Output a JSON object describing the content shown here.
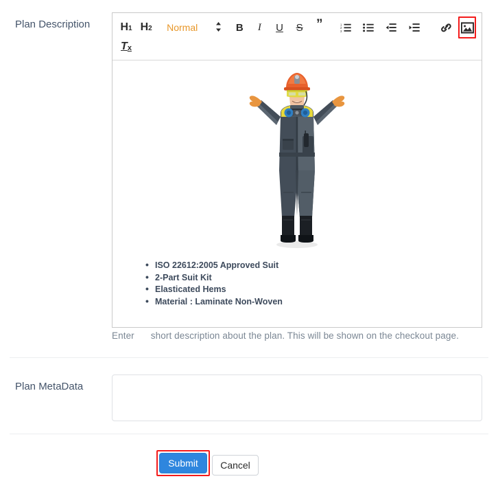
{
  "form": {
    "description_label": "Plan Description",
    "metadata_label": "Plan MetaData",
    "help_text_start": "Enter",
    "help_text_end": "short description about the plan. This will be shown on the checkout page.",
    "metadata_value": "",
    "metadata_placeholder": ""
  },
  "editor": {
    "toolbar": {
      "h1_label": "H",
      "h1_sub": "1",
      "h2_label": "H",
      "h2_sub": "2",
      "format_select_value": "Normal",
      "format_select_caret": "⇕",
      "bold_label": "B",
      "italic_label": "I",
      "underline_label": "U",
      "strike_label": "S",
      "blockquote_label": "”",
      "ordered_list_name": "ordered-list",
      "bullet_list_name": "bullet-list",
      "outdent_name": "outdent",
      "indent_name": "indent",
      "link_name": "link",
      "image_name": "image",
      "clear_format_label": "T",
      "clear_format_sub": "x"
    },
    "content": {
      "image_alt": "Worker wearing protective coverall suit with arms outstretched",
      "bullets": [
        "ISO 22612:2005 Approved Suit",
        "2-Part Suit Kit",
        "Elasticated Hems",
        "Material : Laminate Non-Woven"
      ]
    }
  },
  "actions": {
    "submit_label": "Submit",
    "cancel_label": "Cancel"
  },
  "colors": {
    "submit_blue": "#2e86de",
    "highlight_red": "#f41b1b",
    "label_slate": "#44546a",
    "select_orange": "#e8972a",
    "help_gray": "#7b8794"
  }
}
